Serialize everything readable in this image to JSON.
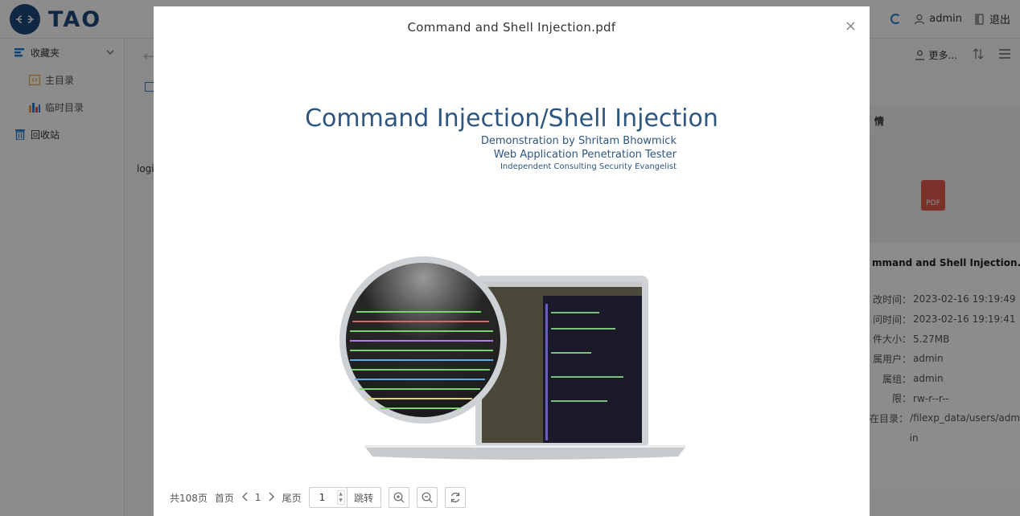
{
  "app": {
    "logo_text": "TAO",
    "user": "admin",
    "logout": "退出",
    "more": "更多..."
  },
  "sidebar": {
    "favorites": "收藏夹",
    "items": [
      {
        "label": "主目录"
      },
      {
        "label": "临时目录"
      }
    ],
    "recycle": "回收站"
  },
  "content": {
    "partial_text": "logi"
  },
  "detail": {
    "head": "情",
    "badge": "PDF",
    "filename": "mmand and Shell Injection.p",
    "rows": [
      {
        "label": "改时间",
        "value": "2023-02-16 19:19:49"
      },
      {
        "label": "问时间",
        "value": "2023-02-16 19:19:41"
      },
      {
        "label": "件大小",
        "value": "5.27MB"
      },
      {
        "label": "属用户",
        "value": "admin"
      },
      {
        "label": "属组",
        "value": "admin"
      },
      {
        "label": "限",
        "value": "rw-r--r--"
      },
      {
        "label": "在目录",
        "value": "/filexp_data/users/adm"
      },
      {
        "label": "",
        "value": "in"
      }
    ]
  },
  "modal": {
    "title": "Command and Shell Injection.pdf",
    "close": "×",
    "slide": {
      "title": "Command Injection/Shell Injection",
      "line1": "Demonstration by Shritam Bhowmick",
      "line2": "Web Application Penetration Tester",
      "line3": "Independent Consulting Security Evangelist"
    },
    "pager": {
      "total": "共108页",
      "first": "首页",
      "current": "1",
      "last": "尾页",
      "input_value": "1",
      "go": "跳转"
    }
  },
  "colors": {
    "brand": "#1e4a7a",
    "slide_text": "#2d5680",
    "pdf_red": "#e15a4e"
  }
}
